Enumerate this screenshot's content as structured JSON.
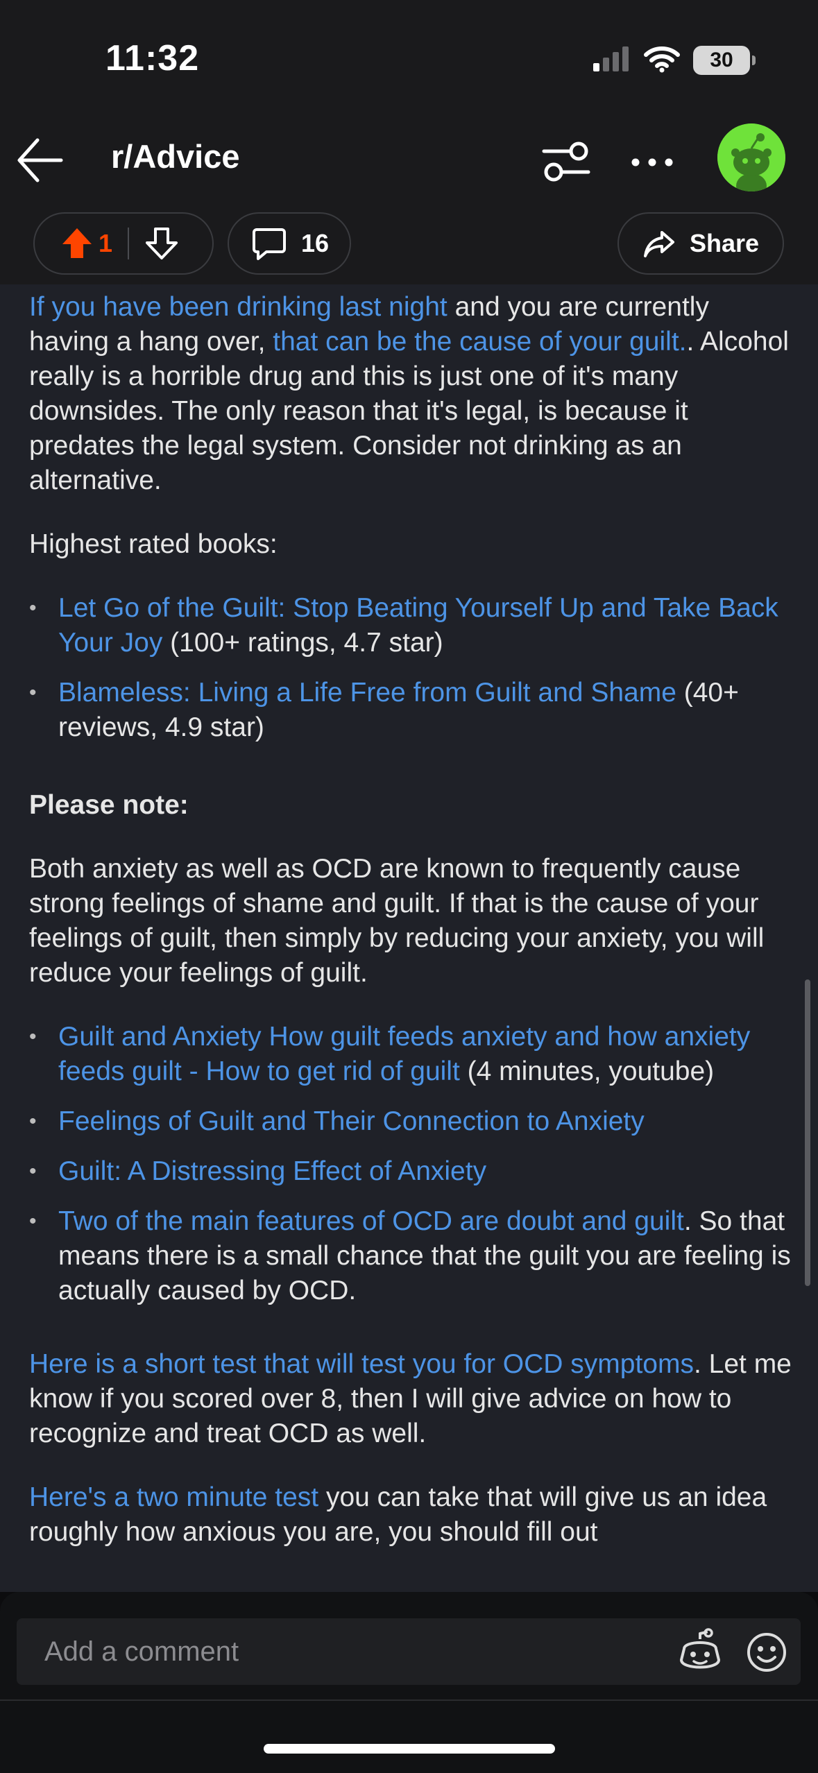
{
  "status_bar": {
    "time": "11:32",
    "battery": "30",
    "icons": [
      "cellular-signal-icon",
      "wifi-icon",
      "battery-icon"
    ]
  },
  "header": {
    "subreddit": "r/Advice",
    "icons": [
      "back-arrow-icon",
      "filter-icon",
      "more-options-icon",
      "snoo-avatar-icon"
    ],
    "avatar_color": "#6fe23a"
  },
  "actions": {
    "vote_count": "1",
    "comment_count": "16",
    "share_label": "Share",
    "upvote_color": "#ff4500"
  },
  "content": {
    "para1": {
      "link1": "If you have been drinking last night",
      "text1": " and you are currently having a hang over, ",
      "link2": "that can be the cause of your guilt.",
      "text2": ". Alcohol really is a horrible drug and this is just one of it's many downsides. The only reason that it's legal, is because it predates the legal system. Consider not drinking as an alternative."
    },
    "books_heading": "Highest rated books:",
    "books": [
      {
        "link": "Let Go of the Guilt: Stop Beating Yourself Up and Take Back Your Joy",
        "text": " (100+ ratings, 4.7 star)"
      },
      {
        "link": "Blameless: Living a Life Free from Guilt and Shame",
        "text": " (40+ reviews, 4.9 star)"
      }
    ],
    "note_heading": "Please note:",
    "note_text": "Both anxiety as well as OCD are known to frequently cause strong feelings of shame and guilt. If that is the cause of your feelings of guilt, then simply by reducing your anxiety, you will reduce your feelings of guilt.",
    "resources": [
      {
        "link": "Guilt and Anxiety How guilt feeds anxiety and how anxiety feeds guilt - How to get rid of guilt",
        "text": " (4 minutes, youtube)"
      },
      {
        "link": "Feelings of Guilt and Their Connection to Anxiety",
        "text": ""
      },
      {
        "link": "Guilt: A Distressing Effect of Anxiety",
        "text": ""
      },
      {
        "link": "Two of the main features of OCD are doubt and guilt",
        "text": ". So that means there is a small chance that the guilt you are feeling is actually caused by OCD."
      }
    ],
    "ocd_para": {
      "link": "Here is a short test that will test you for OCD symptoms",
      "text": ". Let me know if you scored over 8, then I will give advice on how to recognize and treat OCD as well."
    },
    "test_para": {
      "link": "Here's a two minute test",
      "text": " you can take that will give us an idea roughly how anxious you are, you should fill out"
    },
    "link_color": "#4d94e6"
  },
  "comment_bar": {
    "placeholder": "Add a comment",
    "icons": [
      "snoo-face-icon",
      "emoji-icon"
    ]
  }
}
